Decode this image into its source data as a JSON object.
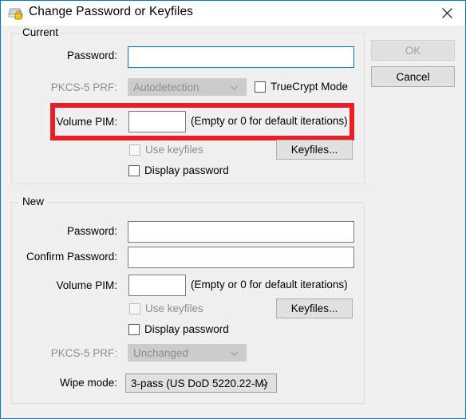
{
  "window": {
    "title": "Change Password or Keyfiles",
    "icon": "drive-lock-icon",
    "close_label": "✕",
    "accent_color": "#0078d7",
    "highlight_color": "#ec1c24"
  },
  "buttons": {
    "ok": "OK",
    "cancel": "Cancel"
  },
  "current": {
    "group_label": "Current",
    "password_label": "Password:",
    "password_value": "",
    "prf_label": "PKCS-5 PRF:",
    "prf_value": "Autodetection",
    "truecrypt_mode_label": "TrueCrypt Mode",
    "pim_label": "Volume PIM:",
    "pim_value": "",
    "pim_hint": "(Empty or 0 for default iterations)",
    "use_keyfiles_label": "Use keyfiles",
    "keyfiles_button": "Keyfiles...",
    "display_password_label": "Display password"
  },
  "new": {
    "group_label": "New",
    "password_label": "Password:",
    "password_value": "",
    "confirm_password_label": "Confirm Password:",
    "confirm_password_value": "",
    "pim_label": "Volume PIM:",
    "pim_value": "",
    "pim_hint": "(Empty or 0 for default iterations)",
    "use_keyfiles_label": "Use keyfiles",
    "keyfiles_button": "Keyfiles...",
    "display_password_label": "Display password",
    "prf_label": "PKCS-5 PRF:",
    "prf_value": "Unchanged",
    "wipe_mode_label": "Wipe mode:",
    "wipe_mode_value": "3-pass (US DoD 5220.22-M)"
  }
}
